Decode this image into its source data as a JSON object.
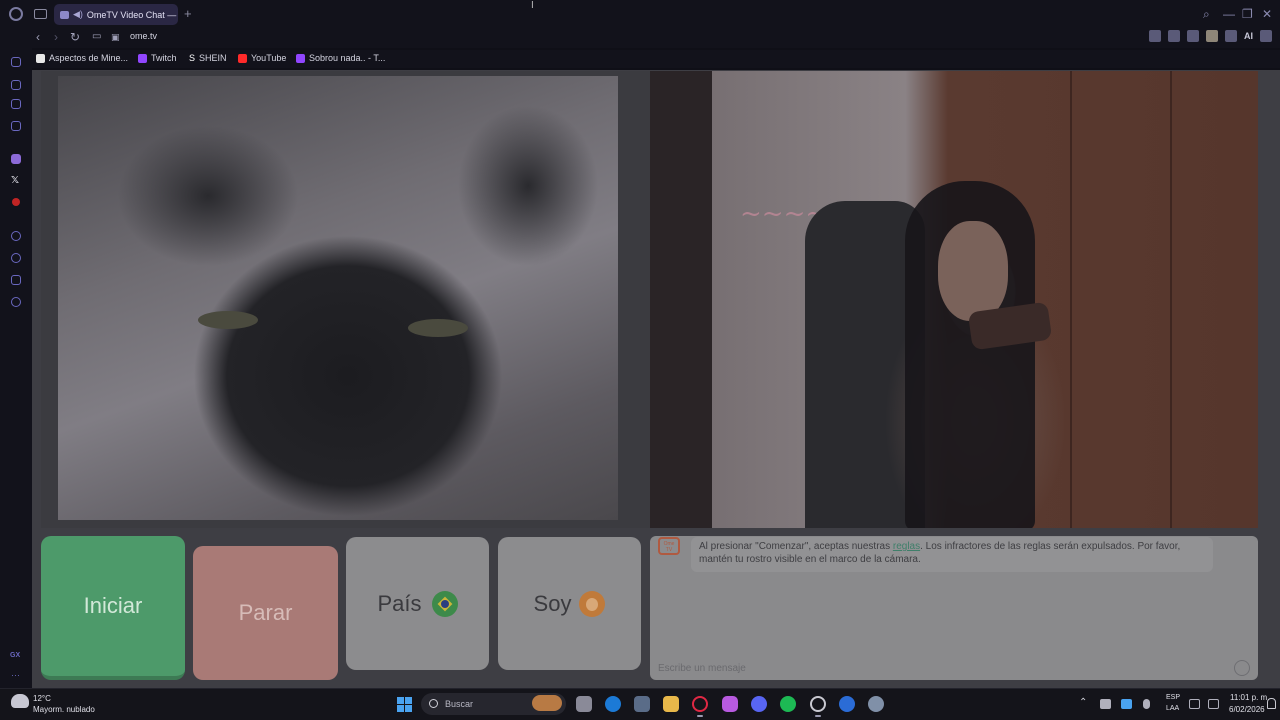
{
  "browser": {
    "tab_title": "OmeTV Video Chat — ",
    "new_tab": "+",
    "url": "ome.tv",
    "ai_label": "AI",
    "bookmarks": [
      {
        "label": "Aspectos de Mine...",
        "color": "#e8e8e8"
      },
      {
        "label": "Twitch",
        "color": "#9146ff"
      },
      {
        "label": "SHEIN",
        "color": "#ffffff"
      },
      {
        "label": "YouTube",
        "color": "#ff2a2a"
      },
      {
        "label": "Sobrou nada.. - T...",
        "color": "#9146ff"
      }
    ],
    "sidebar_gx": "GX",
    "sidebar_more": "···"
  },
  "ometv": {
    "start_label": "Iniciar",
    "stop_label": "Parar",
    "country_label": "País",
    "me_label": "Soy",
    "tv_logo": "Ome TV",
    "notice_before": "Al presionar \"Comenzar\", aceptas nuestras ",
    "notice_link": "reglas",
    "notice_after": ". Los infractores de las reglas serán expulsados. Por favor, mantén tu rostro visible en el marco de la cámara.",
    "message_placeholder": "Escribe un mensaje",
    "colors": {
      "start": "#4d9a6a",
      "stop": "#a97a76",
      "panel": "#8c8c8e"
    }
  },
  "taskbar": {
    "weather_temp": "12°C",
    "weather_desc": "Mayorm. nublado",
    "search_placeholder": "Buscar",
    "lang_top": "ESP",
    "lang_bottom": "LAA",
    "time": "11:01 p. m.",
    "date": "6/02/2026"
  }
}
